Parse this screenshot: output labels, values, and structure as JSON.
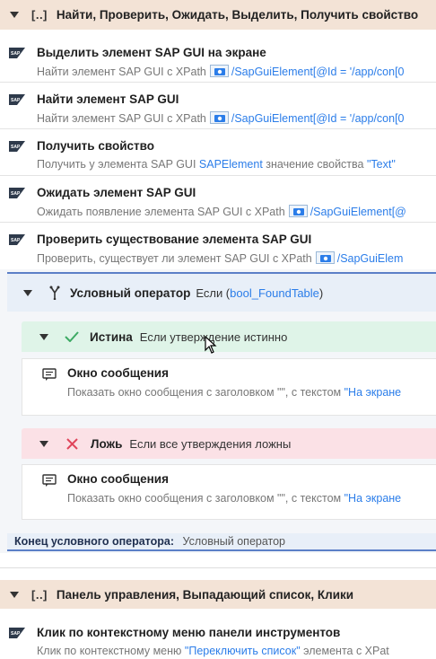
{
  "group1": {
    "title": "Найти, Проверить, Ожидать, Выделить, Получить свойство",
    "bracket": "[..]"
  },
  "actions": [
    {
      "title": "Выделить элемент SAP GUI на экране",
      "desc_prefix": "Найти элемент SAP GUI с XPath",
      "desc_link": "/SapGuiElement[@Id = '/app/con[0"
    },
    {
      "title": "Найти элемент SAP GUI",
      "desc_prefix": "Найти элемент SAP GUI с XPath",
      "desc_link": "/SapGuiElement[@Id = '/app/con[0"
    },
    {
      "title": "Получить свойство",
      "desc_prefix": "Получить у элемента SAP GUI",
      "desc_link": "SAPElement",
      "desc_suffix": "значение свойства",
      "desc_link2": "\"Text\""
    },
    {
      "title": "Ожидать элемент SAP GUI",
      "desc_prefix": "Ожидать появление элемента SAP GUI с XPath",
      "desc_link": "/SapGuiElement[@"
    },
    {
      "title": "Проверить существование элемента SAP GUI",
      "desc_prefix": "Проверить, существует ли элемент SAP GUI с XPath",
      "desc_link": "/SapGuiElem"
    }
  ],
  "condition": {
    "title": "Условный оператор",
    "desc_prefix": "Если (",
    "desc_var": "bool_FoundTable",
    "desc_suffix": ")",
    "true_branch": {
      "title": "Истина",
      "desc": "Если утверждение истинно"
    },
    "false_branch": {
      "title": "Ложь",
      "desc": "Если все утверждения ложны"
    },
    "msg1": {
      "title": "Окно сообщения",
      "desc_prefix": "Показать окно сообщения с заголовком \"\", с текстом",
      "desc_link": "\"На экране"
    },
    "msg2": {
      "title": "Окно сообщения",
      "desc_prefix": "Показать окно сообщения с заголовком \"\", с текстом",
      "desc_link": "\"На экране"
    },
    "end_label": "Конец условного оператора:",
    "end_value": "Условный оператор"
  },
  "group2": {
    "title": "Панель управления, Выпадающий список, Клики",
    "bracket": "[..]"
  },
  "last_action": {
    "title": "Клик по контекстному меню панели инструментов",
    "desc_prefix": "Клик по контекстному меню",
    "desc_link": "\"Переключить список\"",
    "desc_suffix": "элемента с XPat"
  },
  "colors": {
    "group_header": "#f3e3d6",
    "condition_bg": "#e8eff8",
    "true_bg": "#dff4e8",
    "false_bg": "#fbe1e6",
    "link": "#2b7de9"
  }
}
